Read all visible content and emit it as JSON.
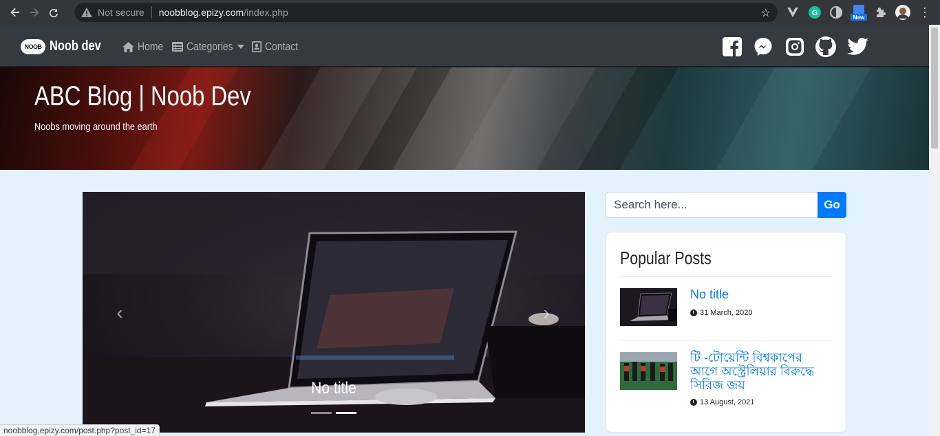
{
  "browser": {
    "security_text": "Not secure",
    "url_host": "noobblog.epizy.com",
    "url_path": "/index.php",
    "extensions": [
      "vue-devtools-icon",
      "grammarly-icon",
      "dark-reader-icon",
      "new-badge-icon",
      "puzzle-icon",
      "profile-avatar"
    ],
    "new_badge": "New"
  },
  "site": {
    "logo_text": "NOOB",
    "brand": "Noob dev",
    "nav": [
      {
        "label": "Home",
        "icon": "home-icon"
      },
      {
        "label": "Categories",
        "icon": "list-icon"
      },
      {
        "label": "Contact",
        "icon": "contact-icon"
      }
    ],
    "social": [
      "facebook-icon",
      "messenger-icon",
      "instagram-icon",
      "github-icon",
      "twitter-icon"
    ]
  },
  "hero": {
    "title": "ABC Blog | Noob Dev",
    "tagline": "Noobs moving around the earth"
  },
  "carousel": {
    "caption": "No title",
    "prev_glyph": "‹",
    "next_glyph": "›",
    "indicators": 2,
    "active_index": 1
  },
  "sidebar": {
    "search_placeholder": "Search here...",
    "go_label": "Go",
    "popular_title": "Popular Posts",
    "posts": [
      {
        "title": "No title",
        "date": "31 March, 2020"
      },
      {
        "title": "টি -টোয়েন্টি বিশ্বকাপের আগে অস্ট্রেলিয়ার বিরুদ্ধে সিরিজ জয়",
        "date": "13 August, 2021"
      }
    ]
  },
  "status_url": "noobblog.epizy.com/post.php?post_id=17",
  "colors": {
    "accent": "#007bff",
    "navbar": "#343a40",
    "page_bg": "#e3f2fd"
  }
}
